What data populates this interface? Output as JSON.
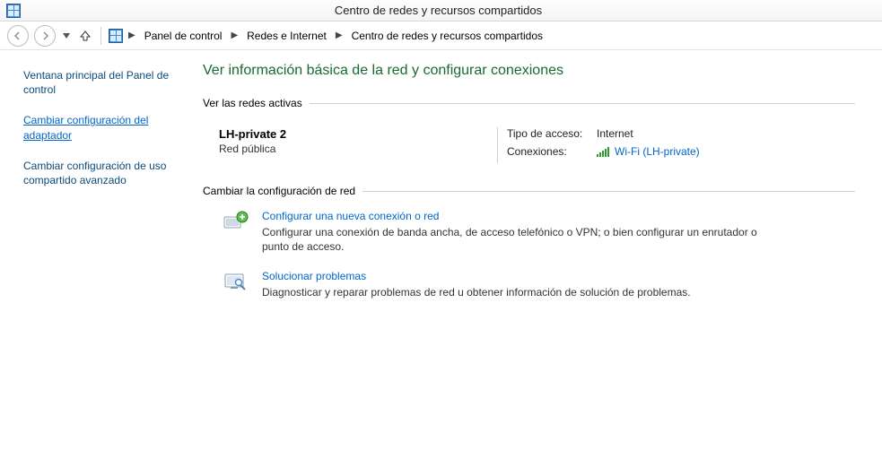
{
  "window": {
    "title": "Centro de redes y recursos compartidos"
  },
  "breadcrumb": {
    "items": [
      "Panel de control",
      "Redes e Internet",
      "Centro de redes y recursos compartidos"
    ]
  },
  "sidebar": {
    "items": [
      {
        "label": "Ventana principal del Panel de control",
        "underline": false
      },
      {
        "label": "Cambiar configuración del adaptador",
        "underline": true
      },
      {
        "label": "Cambiar configuración de uso compartido avanzado",
        "underline": false
      }
    ]
  },
  "main": {
    "page_title": "Ver información básica de la red y configurar conexiones",
    "active_networks_label": "Ver las redes activas",
    "network": {
      "name": "LH-private  2",
      "type": "Red pública",
      "access_label": "Tipo de acceso:",
      "access_value": "Internet",
      "connections_label": "Conexiones:",
      "connection_link": "Wi-Fi (LH-private)"
    },
    "change_config_label": "Cambiar la configuración de red",
    "options": [
      {
        "title": "Configurar una nueva conexión o red",
        "desc": "Configurar una conexión de banda ancha, de acceso telefónico o VPN; o bien configurar un enrutador o punto de acceso."
      },
      {
        "title": "Solucionar problemas",
        "desc": "Diagnosticar y reparar problemas de red u obtener información de solución de problemas."
      }
    ]
  }
}
